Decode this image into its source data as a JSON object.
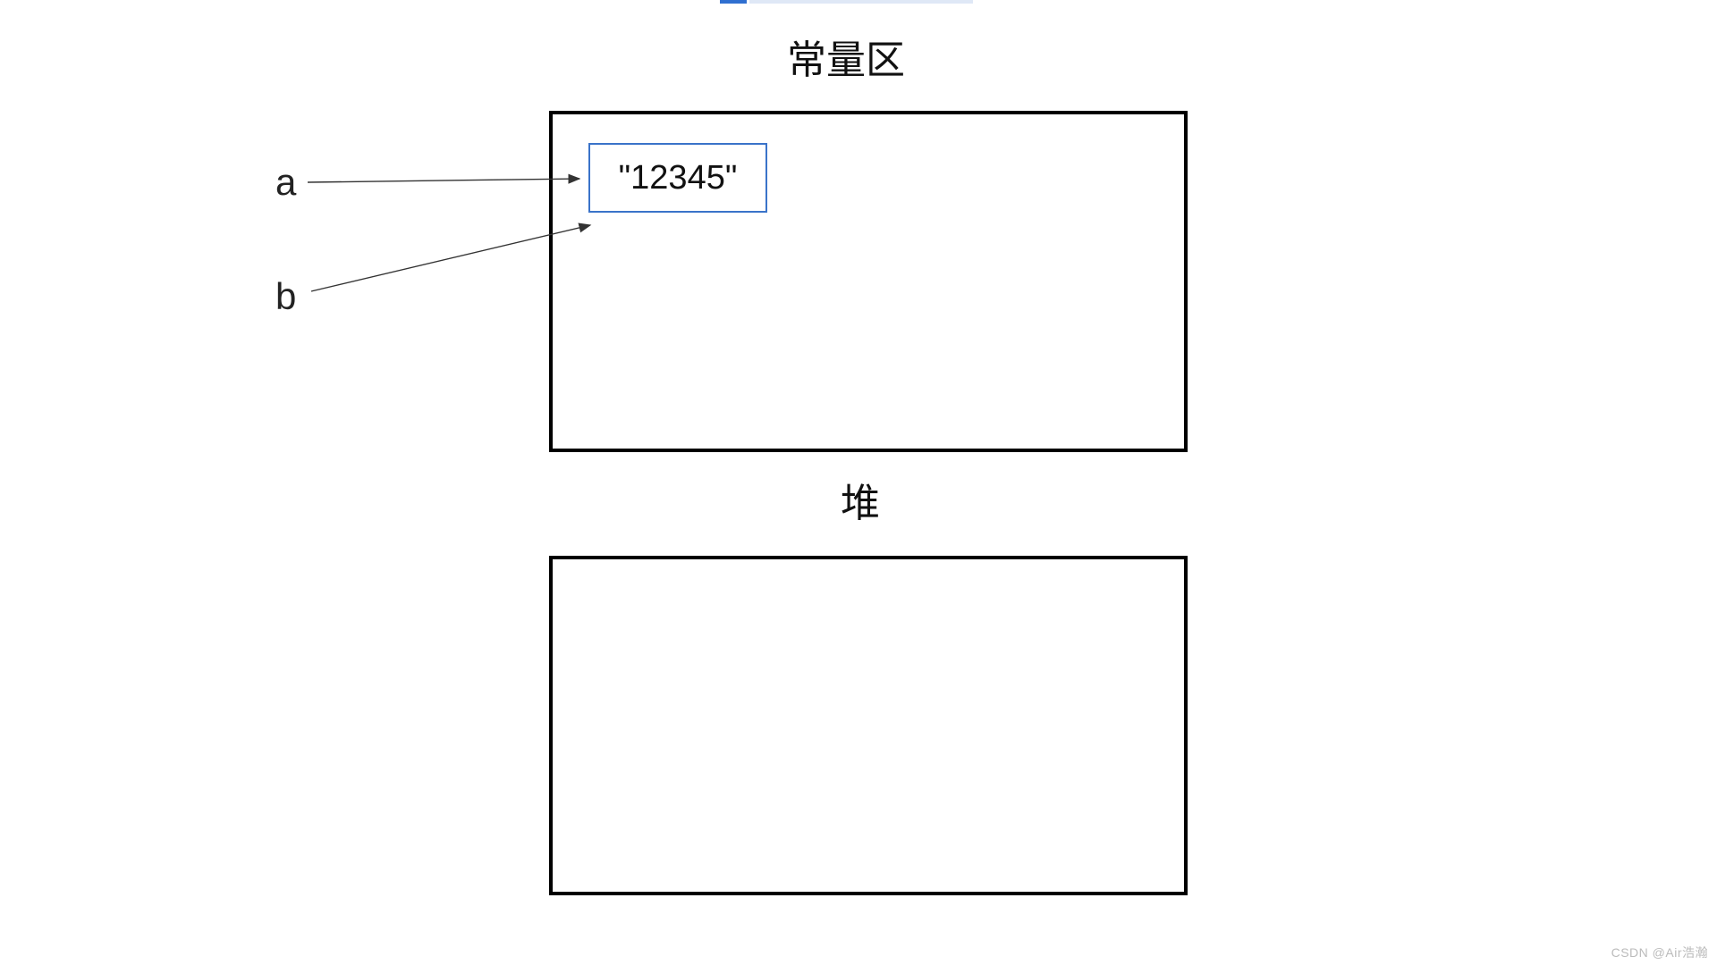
{
  "diagram": {
    "constant_area": {
      "title": "常量区",
      "string_value": "\"12345\""
    },
    "heap": {
      "title": "堆"
    },
    "variables": {
      "a": "a",
      "b": "b"
    },
    "watermark": "CSDN @Air浩瀚"
  }
}
